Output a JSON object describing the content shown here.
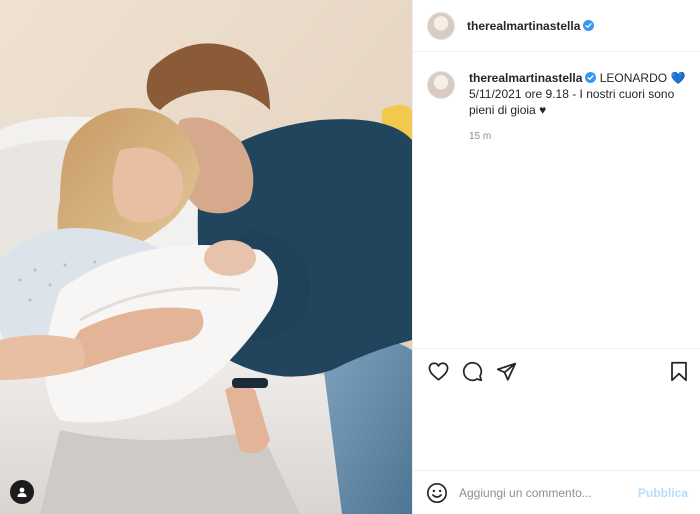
{
  "post": {
    "username": "therealmartinastella",
    "caption_title": "LEONARDO",
    "caption_heart": "💙",
    "caption_text": "5/11/2021 ore 9.18 - I nostri cuori sono pieni di gioia",
    "caption_end_heart": "♥",
    "time_ago": "15 m"
  },
  "actions": {
    "like_icon": "heart-icon",
    "comment_icon": "comment-icon",
    "share_icon": "paper-plane-icon",
    "save_icon": "bookmark-icon"
  },
  "comment_form": {
    "placeholder": "Aggiungi un commento...",
    "publish_label": "Pubblica"
  },
  "colors": {
    "verified_blue": "#3897f0",
    "publish_disabled": "#b2dffc",
    "heart_blue": "#1f5fbf"
  }
}
